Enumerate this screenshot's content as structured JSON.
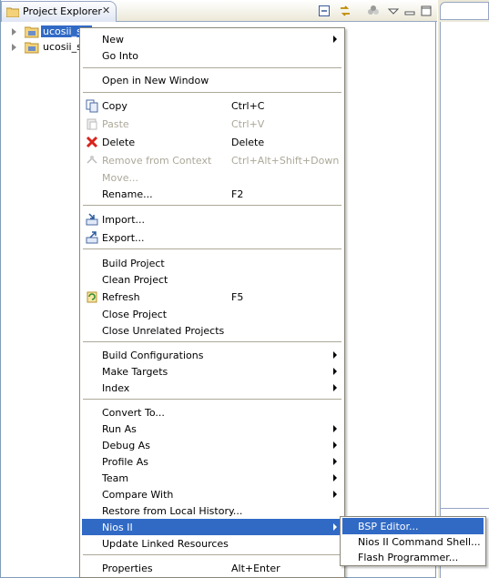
{
  "view": {
    "title": "Project Explorer",
    "close_label": "✕",
    "toolbar_icons": [
      "collapse-all-icon",
      "link-with-editor-icon",
      "filters-icon",
      "view-menu-icon",
      "maximize-icon"
    ]
  },
  "tree": {
    "items": [
      {
        "label": "ucosii_sw",
        "selected": true
      },
      {
        "label": "ucosii_sw",
        "selected": false
      }
    ]
  },
  "menu": {
    "new": "New",
    "go_into": "Go Into",
    "open_new_window": "Open in New Window",
    "copy": "Copy",
    "copy_acc": "Ctrl+C",
    "paste": "Paste",
    "paste_acc": "Ctrl+V",
    "delete": "Delete",
    "delete_acc": "Delete",
    "remove_from_context": "Remove from Context",
    "remove_acc": "Ctrl+Alt+Shift+Down",
    "move": "Move...",
    "rename": "Rename...",
    "rename_acc": "F2",
    "import": "Import...",
    "export": "Export...",
    "build_project": "Build Project",
    "clean_project": "Clean Project",
    "refresh": "Refresh",
    "refresh_acc": "F5",
    "close_project": "Close Project",
    "close_unrelated": "Close Unrelated Projects",
    "build_configurations": "Build Configurations",
    "make_targets": "Make Targets",
    "index": "Index",
    "convert_to": "Convert To...",
    "run_as": "Run As",
    "debug_as": "Debug As",
    "profile_as": "Profile As",
    "team": "Team",
    "compare_with": "Compare With",
    "restore_history": "Restore from Local History...",
    "nios_ii": "Nios II",
    "update_linked": "Update Linked Resources",
    "properties": "Properties",
    "properties_acc": "Alt+Enter"
  },
  "submenu": {
    "bsp_editor": "BSP Editor...",
    "command_shell": "Nios II Command Shell...",
    "flash_programmer": "Flash Programmer..."
  },
  "colors": {
    "selection": "#316ac5",
    "disabled_text": "#aca899"
  }
}
